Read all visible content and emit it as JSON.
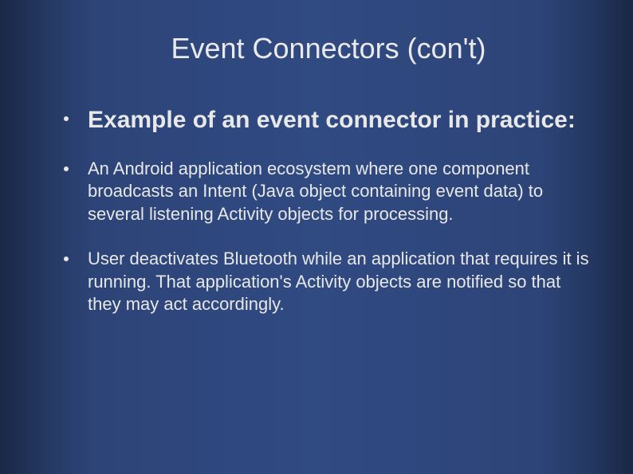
{
  "title": "Event Connectors (con't)",
  "bullets": [
    {
      "text": "Example of an event connector in practice:",
      "style": "heading"
    },
    {
      "text": " An Android application ecosystem where one component broadcasts an Intent (Java object containing event data) to several listening Activity objects for processing.",
      "style": "body"
    },
    {
      "text": "User deactivates Bluetooth while an application that requires it is running.  That application's Activity objects are notified so that they may act accordingly.",
      "style": "body"
    }
  ]
}
